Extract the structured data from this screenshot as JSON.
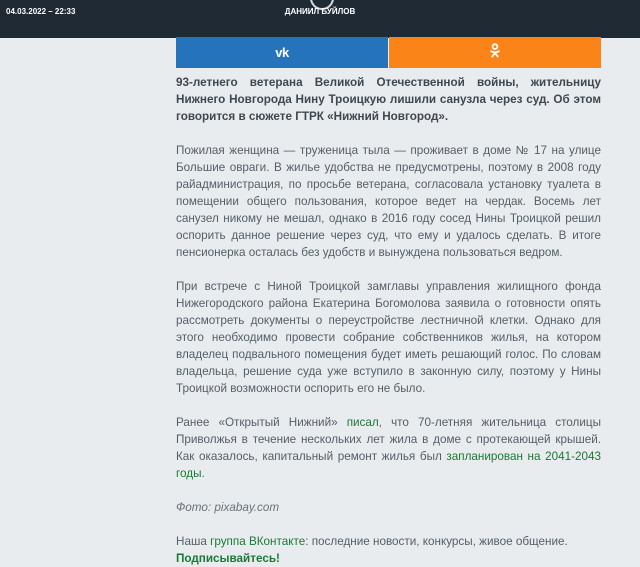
{
  "header": {
    "date": "04.03.2022 – 22:33",
    "author": "ДАНИИЛ БУЙЛОВ"
  },
  "share": {
    "vk_icon": "vk-icon",
    "ok_icon": "odnoklassniki-icon",
    "colors": {
      "vk": "#2574bb",
      "ok": "#fa8417"
    }
  },
  "article": {
    "lead": "93-летнего ветерана Великой Отечественной войны, жительницу Нижнего Новгорода Нину Троицкую лишили санузла через суд. Об этом говорится в сюжете ГТРК «Нижний Новгород».",
    "p1": "Пожилая женщина — труженица тыла — проживает в доме № 17 на улице Большие овраги. В жилье удобства не предусмотрены, поэтому в 2008 году райадминистрация, по просьбе ветерана, согласовала установку туалета в помещении общего пользования, которое ведет на чердак. Восемь лет санузел никому не мешал, однако в 2016 году сосед Нины Троицкой решил оспорить данное решение через суд, что ему и удалось сделать. В итоге пенсионерка осталась без удобств и вынуждена пользоваться ведром.",
    "p2": "При встрече с Ниной Троицкой замглавы управления жилищного фонда Нижегородского района Екатерина Богомолова заявила о готовности опять рассмотреть документы о переустройстве лестничной клетки. Однако для этого необходимо провести собрание собственников жилья, на котором владелец подвального помещения будет иметь решающий голос. По словам владельца, решение суда уже вступило в законную силу, поэтому у Нины Троицкой возможности оспорить его не было.",
    "p3_a": "Ранее «Открытый Нижний» ",
    "p3_link1": "писал",
    "p3_b": ", что 70-летняя жительница столицы Приволжья в течение нескольких лет жила в доме с протекающей крышей. Как оказалось, капитальный ремонт жилья был ",
    "p3_link2": "запланирован на 2041-2043 годы",
    "p3_c": ".",
    "photo_credit": "Фото: pixabay.com",
    "tail_a": "Наша ",
    "tail_link": "группа ВКонтакте",
    "tail_b": ": последние новости, конкурсы, живое общение.",
    "cta": "Подписывайтесь!"
  }
}
